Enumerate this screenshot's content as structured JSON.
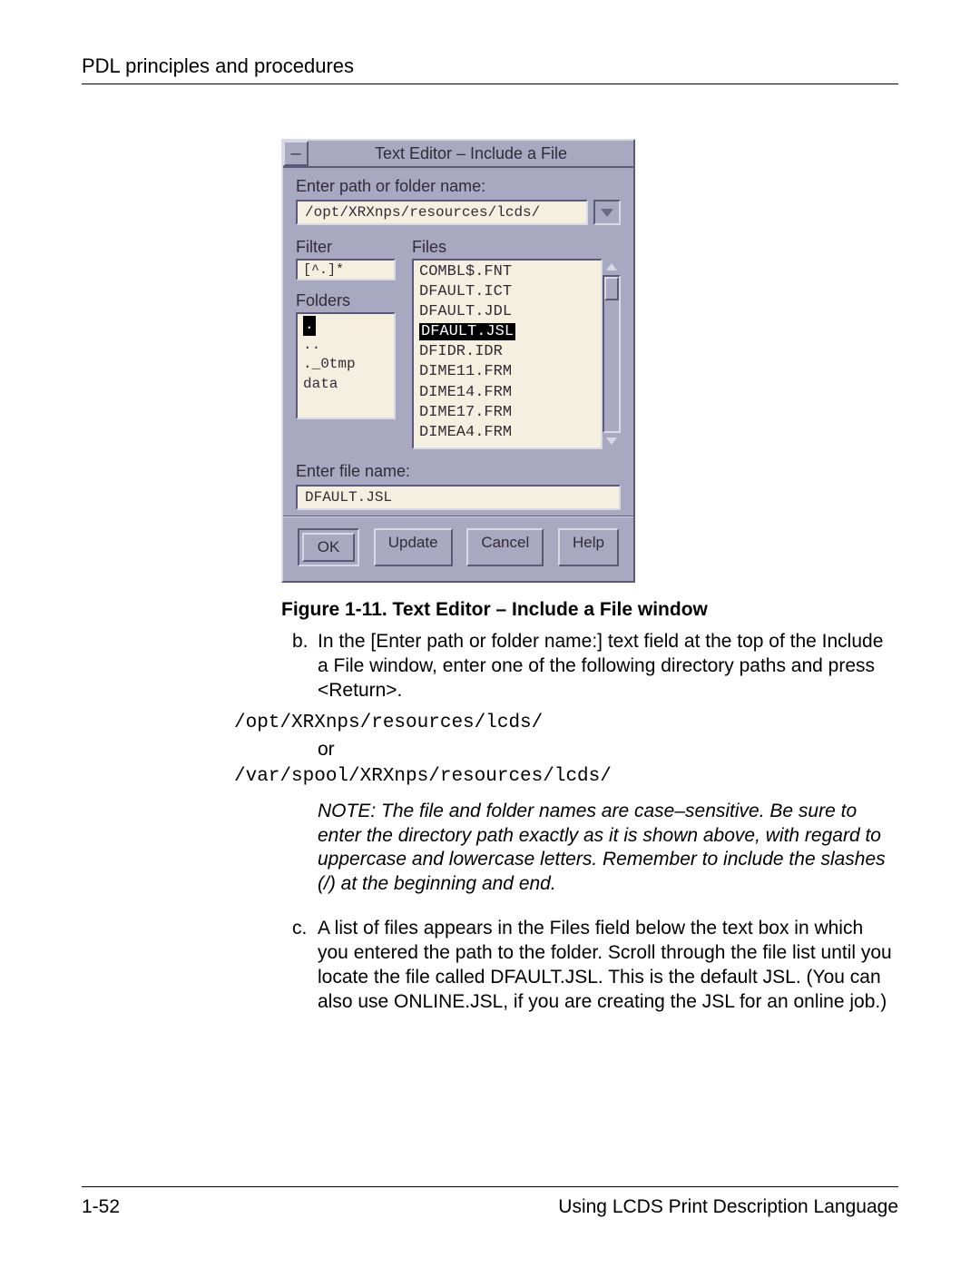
{
  "header": {
    "title": "PDL principles and procedures"
  },
  "dialog": {
    "title": "Text Editor – Include a File",
    "path_prompt": "Enter path or folder name:",
    "path_value": "/opt/XRXnps/resources/lcds/",
    "filter_label": "Filter",
    "filter_value": "[^.]*",
    "folders_label": "Folders",
    "folders": [
      ".",
      "..",
      "._0tmp",
      "data"
    ],
    "folders_selected_index": 0,
    "files_label": "Files",
    "files": [
      "COMBL$.FNT",
      "DFAULT.ICT",
      "DFAULT.JDL",
      "DFAULT.JSL",
      "DFIDR.IDR",
      "DIME11.FRM",
      "DIME14.FRM",
      "DIME17.FRM",
      "DIMEA4.FRM"
    ],
    "files_selected_index": 3,
    "filename_prompt": "Enter file name:",
    "filename_value": "DFAULT.JSL",
    "buttons": {
      "ok": "OK",
      "update": "Update",
      "cancel": "Cancel",
      "help": "Help"
    }
  },
  "caption": "Figure 1-11.  Text Editor – Include a File window",
  "step_b": "In the [Enter path or folder name:] text field at the top of the Include a File window, enter one of the following directory paths and press <Return>.",
  "path1": "/opt/XRXnps/resources/lcds/",
  "or": "or",
  "path2": "/var/spool/XRXnps/resources/lcds/",
  "note": "NOTE:  The file and folder names are case–sensitive. Be sure to enter the directory path exactly as it is shown above, with regard to uppercase and lowercase letters. Remember to include the slashes (/) at the beginning and end.",
  "step_c": "A list of files appears in the Files field below the text box in which you entered the path to the folder. Scroll through the file list until you locate the file called DFAULT.JSL. This is the default JSL. (You can also use ONLINE.JSL, if you are creating the JSL for an online job.)",
  "footer": {
    "page": "1-52",
    "doc": "Using LCDS Print Description Language"
  }
}
